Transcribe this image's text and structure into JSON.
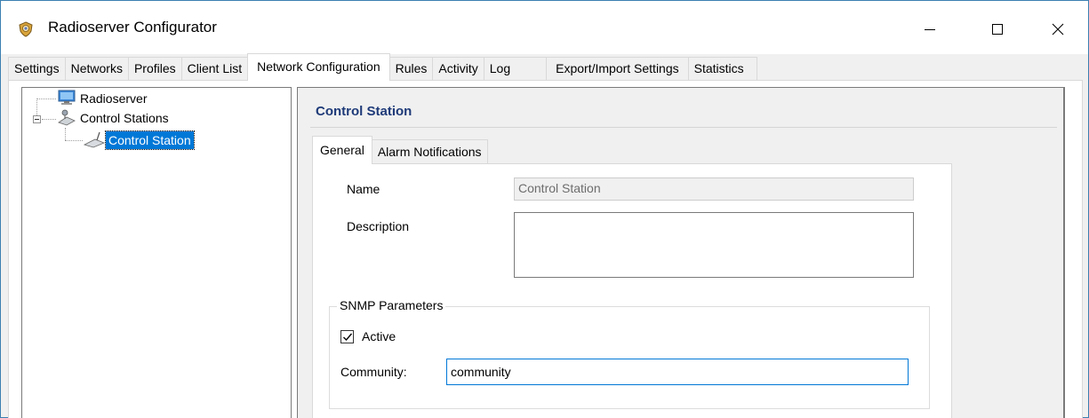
{
  "window": {
    "title": "Radioserver Configurator",
    "icon": "shield-badge-icon",
    "controls": [
      "minimize-icon",
      "maximize-icon",
      "close-icon"
    ]
  },
  "main_tabs": [
    {
      "label": "Settings",
      "active": false
    },
    {
      "label": "Networks",
      "active": false
    },
    {
      "label": "Profiles",
      "active": false
    },
    {
      "label": "Client List",
      "active": false
    },
    {
      "label": "Network Configuration",
      "active": true
    },
    {
      "label": "Rules",
      "active": false
    },
    {
      "label": "Activity",
      "active": false
    },
    {
      "label": "Log",
      "active": false
    },
    {
      "label": "Export/Import Settings",
      "active": false
    },
    {
      "label": "Statistics",
      "active": false
    }
  ],
  "tree": {
    "root": {
      "label": "Radioserver",
      "icon": "monitor-icon"
    },
    "group": {
      "label": "Control Stations",
      "icon": "stations-icon",
      "expanded": true
    },
    "leaf": {
      "label": "Control Station",
      "icon": "radio-device-icon",
      "selected": true
    }
  },
  "detail": {
    "header": "Control Station",
    "tabs": [
      {
        "label": "General",
        "active": true
      },
      {
        "label": "Alarm Notifications",
        "active": false
      }
    ],
    "name_label": "Name",
    "name_value": "Control Station",
    "description_label": "Description",
    "description_value": "",
    "snmp": {
      "legend": "SNMP Parameters",
      "active_label": "Active",
      "active_checked": true,
      "community_label": "Community:",
      "community_value": "community"
    }
  },
  "colors": {
    "accent": "#0078d7",
    "header_text": "#1e3a78",
    "window_border": "#3c7fb1"
  }
}
